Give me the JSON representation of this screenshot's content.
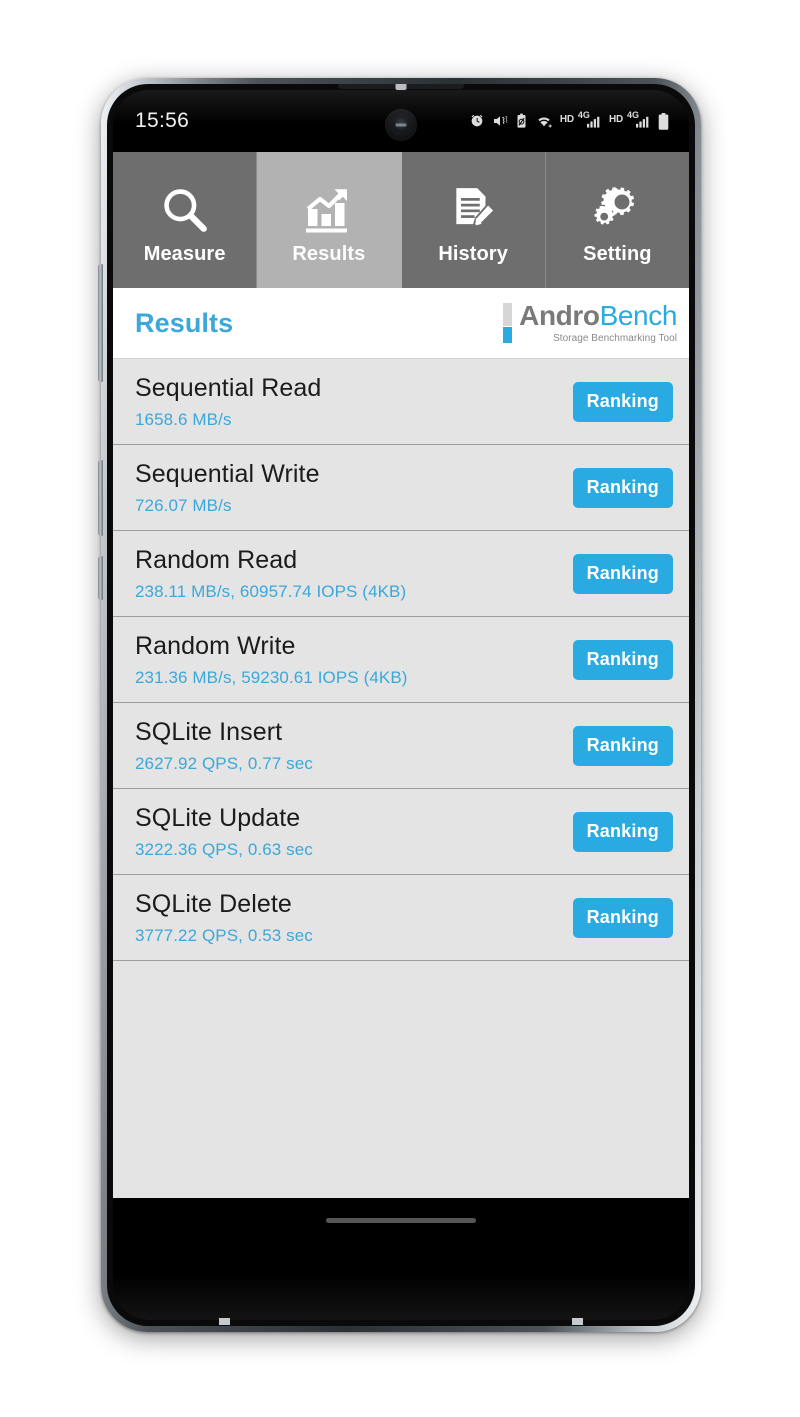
{
  "statusbar": {
    "time": "15:56",
    "icons": [
      {
        "name": "alarm-icon"
      },
      {
        "name": "mute-vibrate-icon"
      },
      {
        "name": "battery-saver-icon"
      },
      {
        "name": "wifi-icon"
      },
      {
        "name": "hd-call-icon",
        "label": "HD"
      },
      {
        "name": "signal-4g-icon-1",
        "label": "4G"
      },
      {
        "name": "hd-call-icon-2",
        "label": "HD"
      },
      {
        "name": "signal-4g-icon-2",
        "label": "4G"
      },
      {
        "name": "battery-icon"
      }
    ]
  },
  "tabs": [
    {
      "label": "Measure",
      "icon": "magnifier-icon",
      "active": false
    },
    {
      "label": "Results",
      "icon": "bar-chart-arrow-icon",
      "active": true
    },
    {
      "label": "History",
      "icon": "document-pencil-icon",
      "active": false
    },
    {
      "label": "Setting",
      "icon": "gears-icon",
      "active": false
    }
  ],
  "header": {
    "title": "Results",
    "logo": {
      "word_primary": "Andro",
      "word_secondary": "Bench",
      "tagline": "Storage Benchmarking Tool"
    }
  },
  "results": {
    "ranking_label": "Ranking",
    "rows": [
      {
        "title": "Sequential Read",
        "value": "1658.6 MB/s"
      },
      {
        "title": "Sequential Write",
        "value": "726.07 MB/s"
      },
      {
        "title": "Random Read",
        "value": "238.11 MB/s, 60957.74 IOPS (4KB)"
      },
      {
        "title": "Random Write",
        "value": "231.36 MB/s, 59230.61 IOPS (4KB)"
      },
      {
        "title": "SQLite Insert",
        "value": "2627.92 QPS, 0.77 sec"
      },
      {
        "title": "SQLite Update",
        "value": "3222.36 QPS, 0.63 sec"
      },
      {
        "title": "SQLite Delete",
        "value": "3777.22 QPS, 0.53 sec"
      }
    ]
  },
  "colors": {
    "accent_blue": "#29abe2",
    "title_blue": "#3aa8da",
    "row_bg": "#e4e4e4",
    "tab_inactive": "#6e6e6e",
    "tab_active": "#b2b2b2"
  }
}
